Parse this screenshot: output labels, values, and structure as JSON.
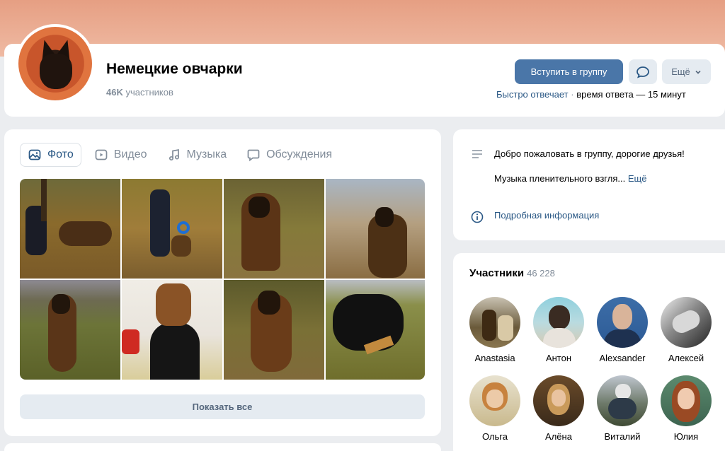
{
  "header": {
    "title": "Немецкие овчарки",
    "members_count": "46K",
    "members_suffix": "участников",
    "join_label": "Вступить в группу",
    "more_label": "Ещё",
    "response_fast": "Быстро отвечает",
    "response_separator": "·",
    "response_time": "время ответа — 15 минут"
  },
  "photos": {
    "tabs": [
      {
        "label": "Фото",
        "icon": "image-icon",
        "active": true
      },
      {
        "label": "Видео",
        "icon": "video-icon",
        "active": false
      },
      {
        "label": "Музыка",
        "icon": "music-icon",
        "active": false
      },
      {
        "label": "Обсуждения",
        "icon": "chat-icon",
        "active": false
      }
    ],
    "show_all_label": "Показать все"
  },
  "info": {
    "welcome": "Добро пожаловать в группу, дорогие друзья!",
    "teaser": "Музыка пленительного взгля...",
    "more_link": "Ещё",
    "details_link": "Подробная информация"
  },
  "members": {
    "title": "Участники",
    "count": "46 228",
    "list": [
      {
        "name": "Anastasia"
      },
      {
        "name": "Антон"
      },
      {
        "name": "Alexsander"
      },
      {
        "name": "Алексей"
      },
      {
        "name": "Ольга"
      },
      {
        "name": "Алёна"
      },
      {
        "name": "Виталий"
      },
      {
        "name": "Юлия"
      }
    ]
  },
  "colors": {
    "accent": "#4a76a8",
    "link": "#2a5885",
    "secondary_text": "#818c99",
    "button_secondary": "#e5ebf1"
  }
}
